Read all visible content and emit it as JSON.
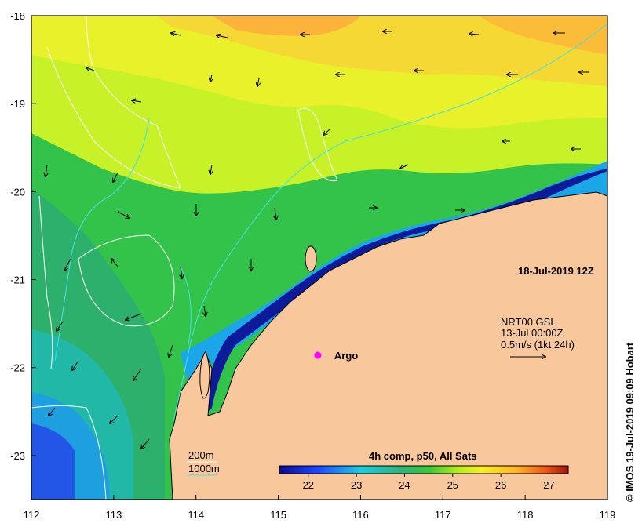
{
  "map": {
    "timestamp": "18-Jul-2019 12Z",
    "credit": "© IMOS 19-Jul-2019 09:09 Hobart",
    "longitude_ticks": [
      "112",
      "113",
      "114",
      "115",
      "116",
      "117",
      "118",
      "119"
    ],
    "latitude_ticks": [
      "-18",
      "-19",
      "-20",
      "-21",
      "-22",
      "-23"
    ],
    "lon_range": [
      112,
      119
    ],
    "lat_range": [
      -23.5,
      -18
    ],
    "argo_label": "Argo",
    "argo_position": {
      "lon": 115.48,
      "lat": -21.86
    },
    "current_legend": {
      "line1": "NRT00 GSL",
      "line2": "13-Jul 00:00Z",
      "line3": "0.5m/s (1kt 24h)"
    },
    "depth_legend": {
      "contour_200": "200m",
      "contour_1000": "1000m"
    },
    "colorbar": {
      "title": "4h comp, p50, All Sats",
      "ticks": [
        "22",
        "23",
        "24",
        "25",
        "26",
        "27"
      ],
      "range": [
        21.4,
        27.4
      ]
    },
    "colors": {
      "land": "#f9c79c",
      "coast": "#000000",
      "argo": "#ff00ff",
      "contour_200": "#ffffff",
      "contour_1000": "#45e0e6"
    }
  }
}
